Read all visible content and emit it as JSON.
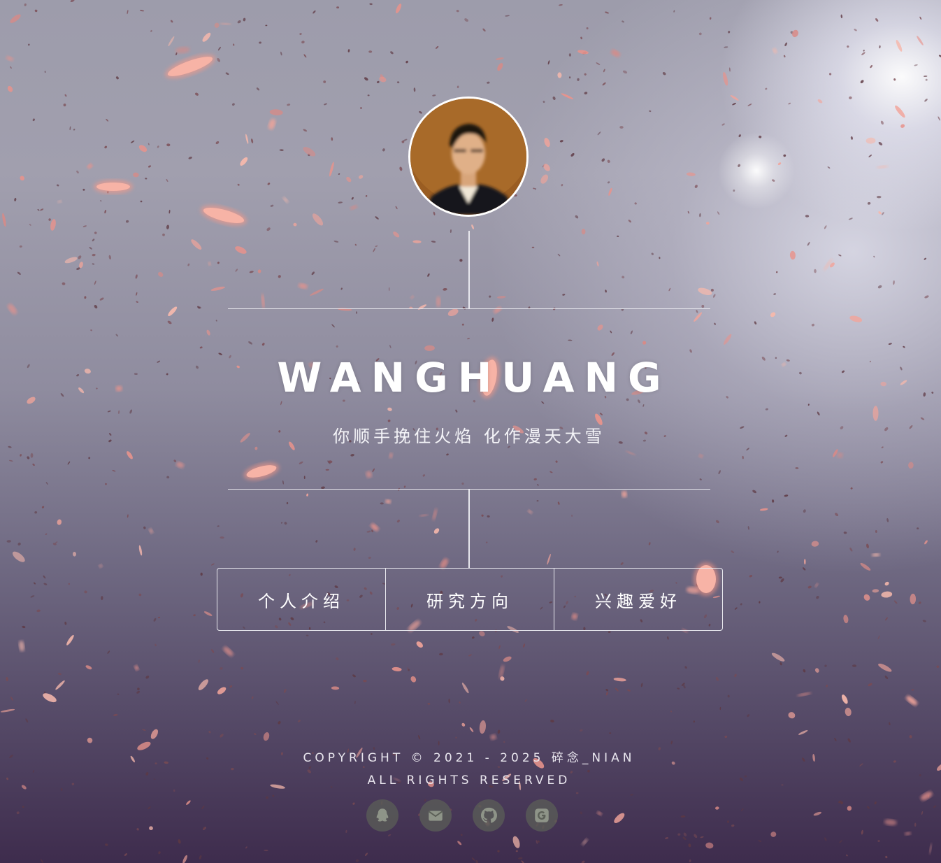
{
  "profile": {
    "name": "WANGHUANG",
    "motto": "你顺手挽住火焰 化作漫天大雪"
  },
  "nav": {
    "items": [
      {
        "label": "个人介绍"
      },
      {
        "label": "研究方向"
      },
      {
        "label": "兴趣爱好"
      }
    ]
  },
  "footer": {
    "copyright": "COPYRIGHT © 2021 - 2025 碎念_NIAN",
    "rights": "ALL RIGHTS RESERVED",
    "socials": [
      {
        "icon": "qq-icon"
      },
      {
        "icon": "mail-icon"
      },
      {
        "icon": "github-icon"
      },
      {
        "icon": "google-icon"
      }
    ]
  },
  "colors": {
    "petal": "#f2a49a",
    "line": "#e8e8ee",
    "social_bg": "#5c6058"
  }
}
